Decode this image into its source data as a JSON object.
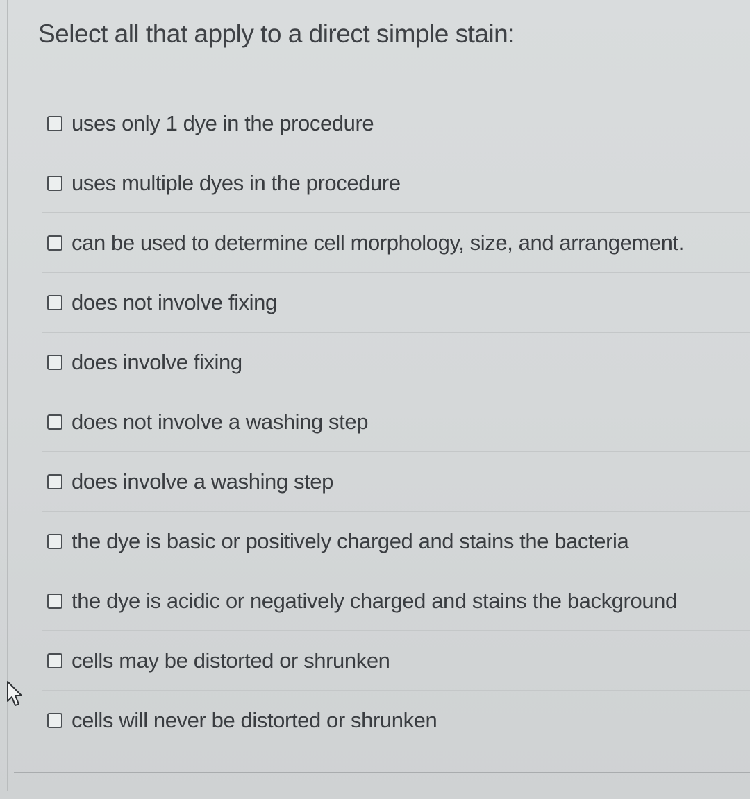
{
  "question": {
    "prompt": "Select all that apply to a direct simple stain:"
  },
  "options": [
    {
      "label": "uses only 1 dye in the procedure",
      "checked": false
    },
    {
      "label": "uses multiple dyes in the procedure",
      "checked": false
    },
    {
      "label": "can be used to determine cell morphology, size, and arrangement.",
      "checked": false
    },
    {
      "label": "does not involve fixing",
      "checked": false
    },
    {
      "label": "does involve fixing",
      "checked": false
    },
    {
      "label": "does not involve a washing step",
      "checked": false
    },
    {
      "label": "does involve a washing step",
      "checked": false
    },
    {
      "label": "the dye is basic or positively charged and stains the bacteria",
      "checked": false
    },
    {
      "label": "the dye is acidic or negatively charged and stains the background",
      "checked": false
    },
    {
      "label": "cells may be distorted or shrunken",
      "checked": false
    },
    {
      "label": "cells will never be distorted or shrunken",
      "checked": false
    }
  ],
  "icons": {
    "cursor": "mouse-pointer-icon",
    "checkbox": "checkbox-unchecked-icon"
  }
}
